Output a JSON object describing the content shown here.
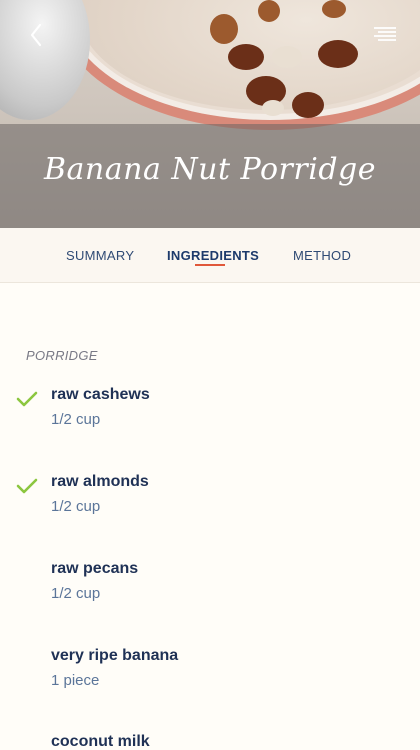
{
  "recipe": {
    "title": "Banana Nut Porridge"
  },
  "tabs": [
    {
      "label": "SUMMARY",
      "active": false
    },
    {
      "label": "INGREDIENTS",
      "active": true
    },
    {
      "label": "METHOD",
      "active": false
    }
  ],
  "section": {
    "label": "PORRIDGE"
  },
  "ingredients": [
    {
      "name": "raw cashews",
      "quantity": "1/2 cup",
      "checked": true
    },
    {
      "name": "raw almonds",
      "quantity": "1/2 cup",
      "checked": true
    },
    {
      "name": "raw pecans",
      "quantity": "1/2 cup",
      "checked": false
    },
    {
      "name": "very ripe banana",
      "quantity": "1  piece",
      "checked": false
    },
    {
      "name": "coconut milk",
      "quantity": "",
      "checked": false
    }
  ],
  "icons": {
    "back": "chevron-left-icon",
    "menu": "menu-icon",
    "check": "checkmark-icon"
  },
  "colors": {
    "accent": "#e0583b",
    "check": "#8cc63f",
    "navy": "#1f3155"
  }
}
